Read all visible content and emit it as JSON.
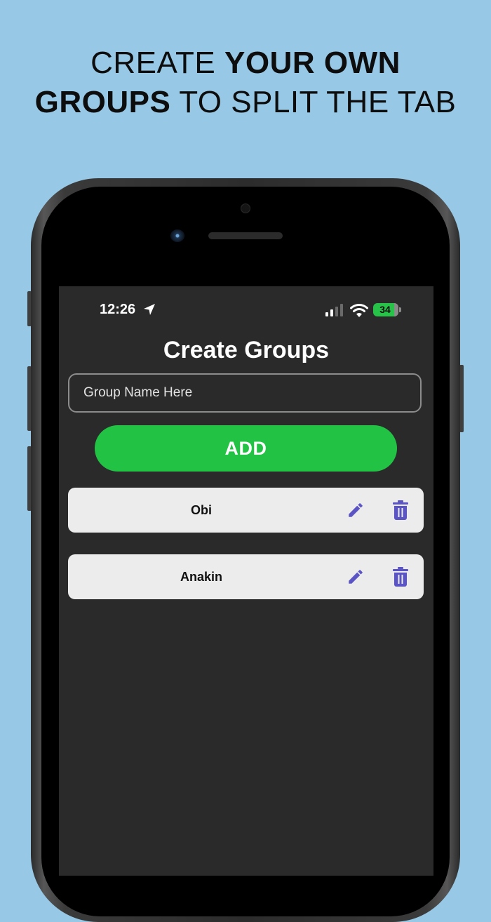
{
  "headline": {
    "line1_regular": "CREATE ",
    "line1_bold": "YOUR OWN",
    "line2_bold": "GROUPS",
    "line2_regular": " TO SPLIT THE TAB"
  },
  "status_bar": {
    "time": "12:26",
    "battery": "34"
  },
  "screen": {
    "title": "Create Groups",
    "input_placeholder": "Group Name Here",
    "add_label": "ADD"
  },
  "groups": [
    {
      "name": "Obi"
    },
    {
      "name": "Anakin"
    }
  ],
  "colors": {
    "background": "#97c8e6",
    "screen_bg": "#2a2a2a",
    "add_button": "#22c245",
    "card_bg": "#ececec",
    "icon_accent": "#5a54c4"
  }
}
